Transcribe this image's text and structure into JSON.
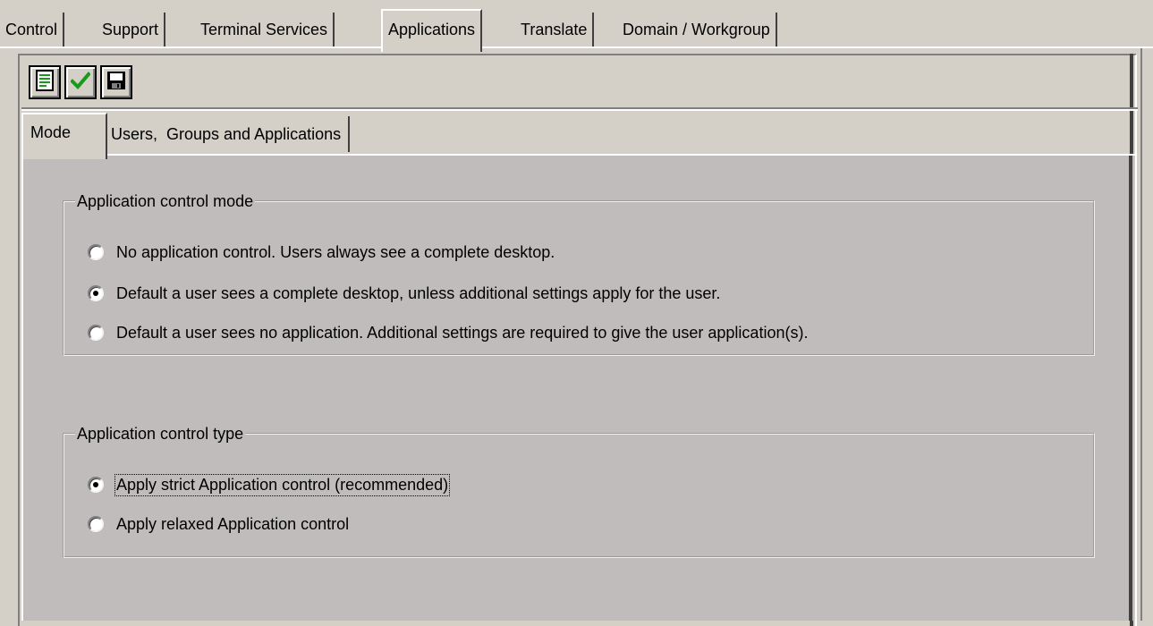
{
  "main_tabs": [
    {
      "label": "Control"
    },
    {
      "label": "Support"
    },
    {
      "label": "Terminal Services"
    },
    {
      "label": "Applications"
    },
    {
      "label": "Translate"
    },
    {
      "label": "Domain / Workgroup"
    }
  ],
  "active_main_tab": "Applications",
  "toolbar": {
    "buttons": [
      {
        "icon": "document-icon"
      },
      {
        "icon": "checkmark-icon"
      },
      {
        "icon": "save-icon"
      }
    ]
  },
  "sub_tabs": [
    {
      "label": "Mode"
    },
    {
      "label": "Users,  Groups and Applications"
    }
  ],
  "active_sub_tab": "Mode",
  "control_mode": {
    "legend": "Application control mode",
    "options": [
      {
        "label": "No application control. Users always see a complete desktop.",
        "checked": false
      },
      {
        "label": "Default a user sees a complete desktop, unless additional settings apply for the user.",
        "checked": true
      },
      {
        "label": "Default a user sees no application. Additional settings are required to give the user application(s).",
        "checked": false
      }
    ]
  },
  "control_type": {
    "legend": "Application control type",
    "options": [
      {
        "label": "Apply strict Application control (recommended)",
        "checked": true
      },
      {
        "label": "Apply relaxed Application control",
        "checked": false
      }
    ]
  },
  "colors": {
    "background": "#d4d0c8",
    "panel": "#c0bcbc",
    "check_green": "#1a9a1a"
  }
}
